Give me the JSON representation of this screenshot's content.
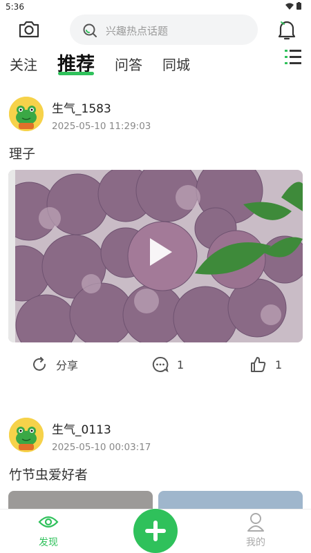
{
  "status": {
    "time": "5:36"
  },
  "header": {
    "search_placeholder": "兴趣热点话题",
    "tabs": [
      "关注",
      "推荐",
      "问答",
      "同城"
    ],
    "active_tab": "推荐"
  },
  "posts": [
    {
      "username": "生气_1583",
      "time": "2025-05-10 11:29:03",
      "content": "理子",
      "share_label": "分享",
      "comment_count": "1",
      "like_count": "1"
    },
    {
      "username": "生气_0113",
      "time": "2025-05-10 00:03:17",
      "content": "竹节虫爱好者"
    }
  ],
  "bottom_nav": {
    "discover": "发现",
    "me": "我的"
  },
  "colors": {
    "accent": "#2fc15b"
  }
}
